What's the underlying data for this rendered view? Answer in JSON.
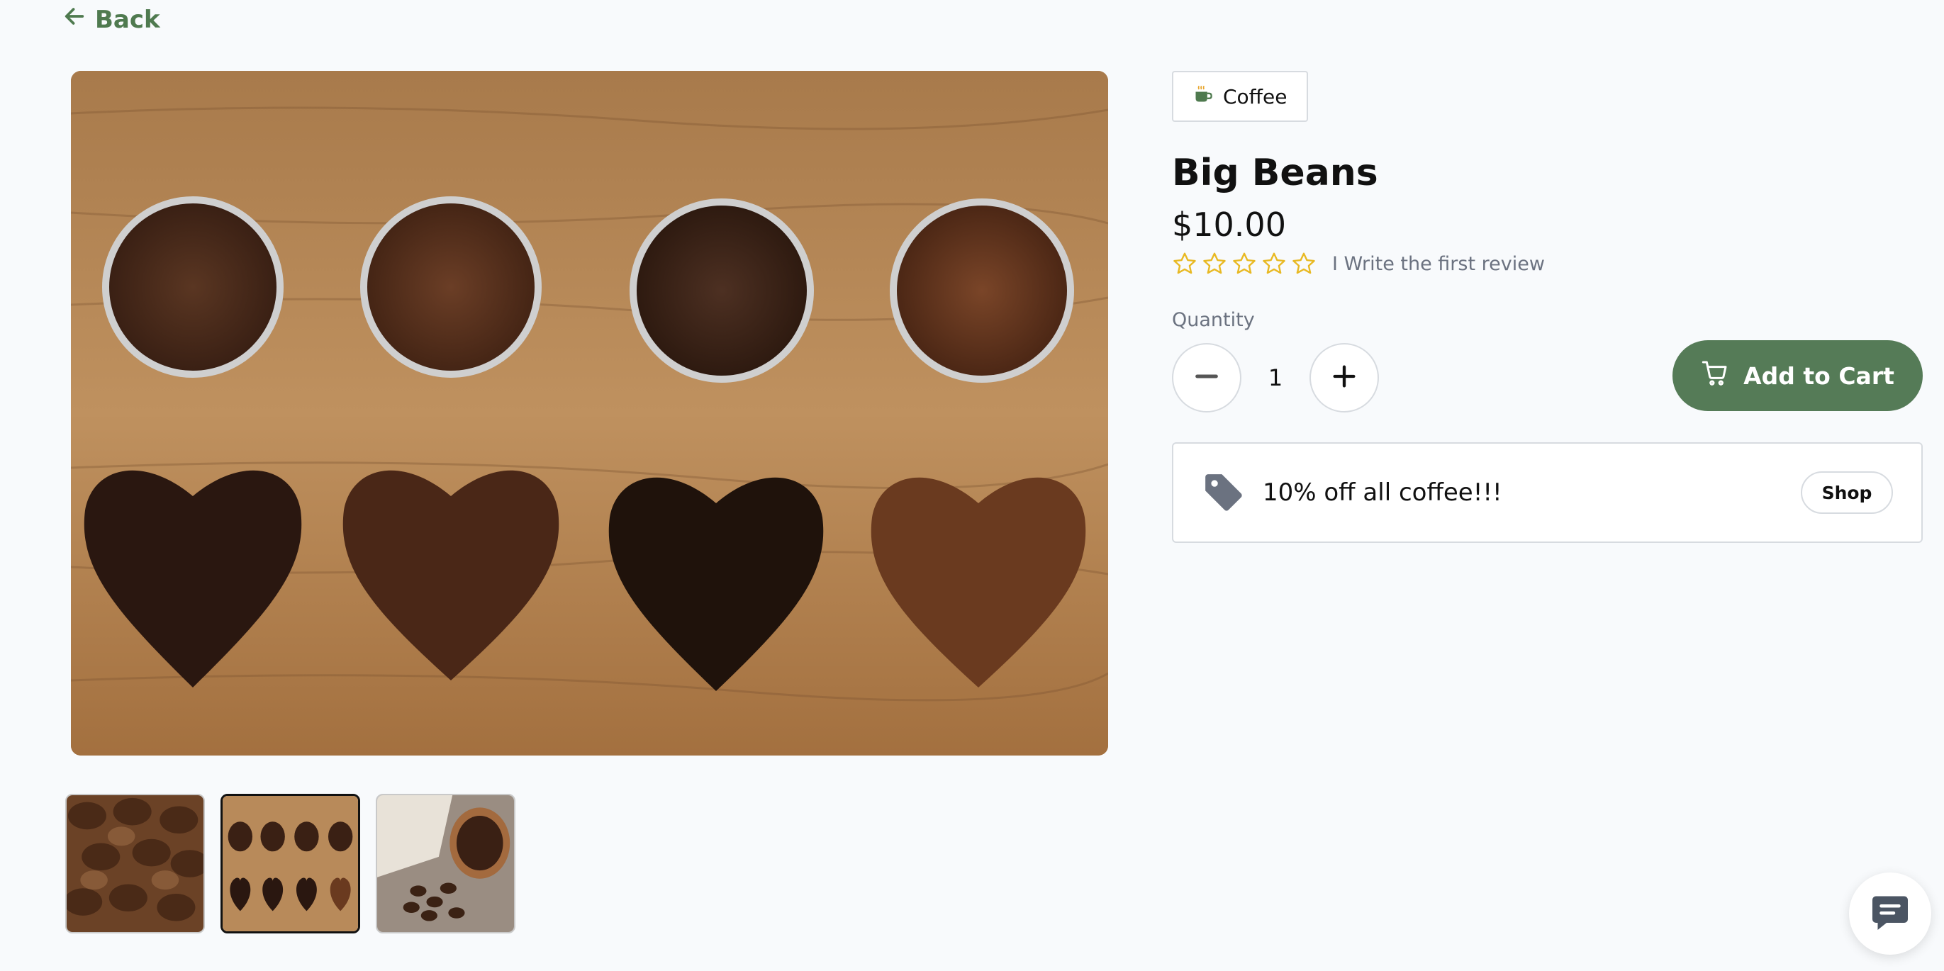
{
  "nav": {
    "back_label": "Back"
  },
  "product": {
    "category": "Coffee",
    "category_icon": "coffee-cup-icon",
    "title": "Big Beans",
    "price": "$10.00",
    "rating": {
      "stars_filled": 0,
      "stars_total": 5,
      "review_link": "I Write the first review"
    },
    "quantity_label": "Quantity",
    "quantity": "1",
    "add_to_cart_label": "Add to Cart"
  },
  "promo": {
    "text": "10% off all coffee!!!",
    "button_label": "Shop"
  },
  "gallery": {
    "thumbnails": [
      {
        "name": "roasted-beans-closeup",
        "selected": false
      },
      {
        "name": "grounds-and-bean-hearts",
        "selected": true
      },
      {
        "name": "beans-sack-and-spoon",
        "selected": false
      }
    ]
  },
  "colors": {
    "brand_green": "#557b57",
    "back_link_green": "#4f7a4f",
    "star_outline": "#e8b923",
    "page_background": "#f8fafc"
  }
}
